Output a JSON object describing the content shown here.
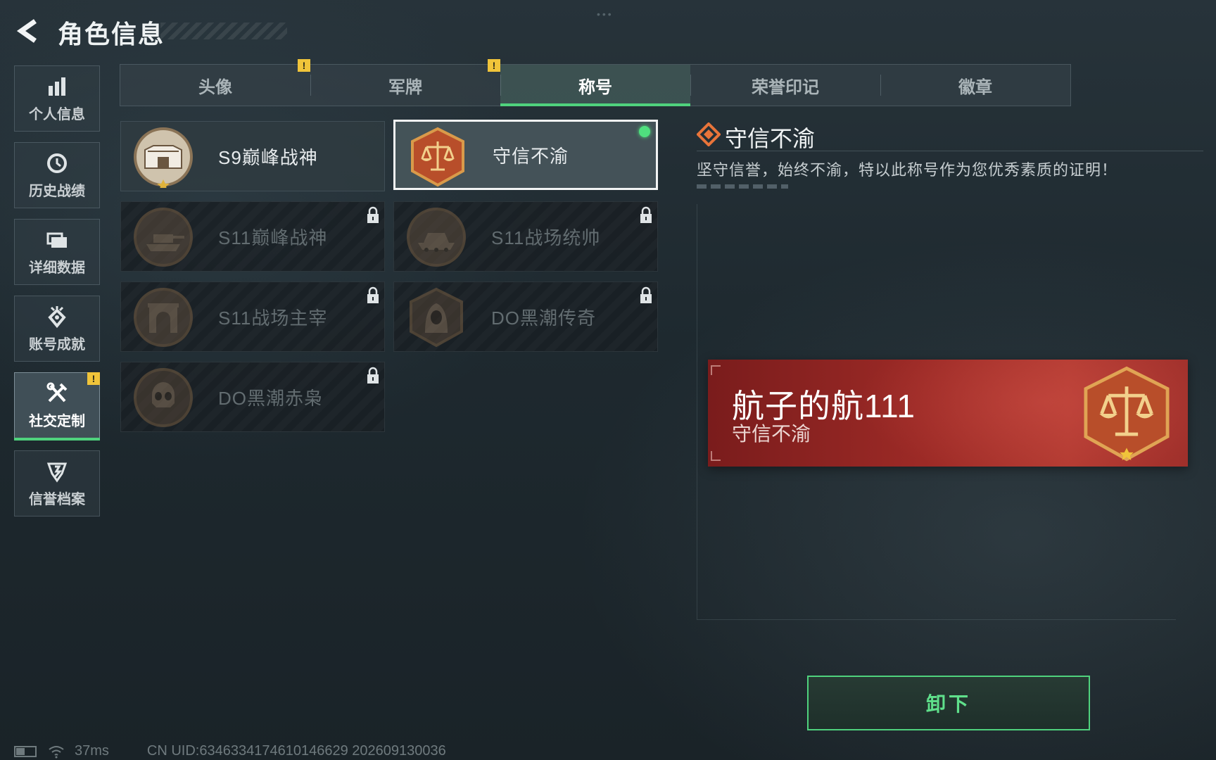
{
  "header": {
    "title": "角色信息"
  },
  "sidebar": {
    "items": [
      {
        "label": "个人信息",
        "icon": "bar-chart-icon"
      },
      {
        "label": "历史战绩",
        "icon": "history-clock-icon"
      },
      {
        "label": "详细数据",
        "icon": "folder-icon"
      },
      {
        "label": "账号成就",
        "icon": "achievement-icon"
      },
      {
        "label": "社交定制",
        "icon": "tools-icon",
        "active": true,
        "alert": "!"
      },
      {
        "label": "信誉档案",
        "icon": "credit-icon"
      }
    ]
  },
  "tabs": [
    {
      "label": "头像",
      "alert": "!"
    },
    {
      "label": "军牌",
      "alert": "!"
    },
    {
      "label": "称号",
      "active": true
    },
    {
      "label": "荣誉印记"
    },
    {
      "label": "徽章"
    }
  ],
  "titles": [
    {
      "name": "S9巅峰战神",
      "medal": "fortress-medal-icon",
      "locked": false
    },
    {
      "name": "守信不渝",
      "medal": "scales-medal-icon",
      "locked": false,
      "selected": true,
      "equipped": true
    },
    {
      "name": "S11巅峰战神",
      "medal": "tank-medal-icon",
      "locked": true
    },
    {
      "name": "S11战场统帅",
      "medal": "vehicle-medal-icon",
      "locked": true
    },
    {
      "name": "S11战场主宰",
      "medal": "arch-medal-icon",
      "locked": true
    },
    {
      "name": "DO黑潮传奇",
      "medal": "hooded-figure-medal-icon",
      "locked": true
    },
    {
      "name": "DO黑潮赤枭",
      "medal": "skull-medal-icon",
      "locked": true
    }
  ],
  "detail": {
    "title": "守信不渝",
    "description": "坚守信誉，始终不渝，特以此称号作为您优秀素质的证明！"
  },
  "nameplate": {
    "player_name": "航子的航111",
    "title": "守信不渝"
  },
  "actions": {
    "unequip_label": "卸下"
  },
  "status": {
    "ping": "37ms",
    "uid": "CN UID:6346334174610146629 202609130036"
  },
  "colors": {
    "accent_green": "#4fd27d",
    "alert_yellow": "#f0c43a",
    "nameplate_red": "#9c2a26",
    "medal_bronze": "#8a6a48"
  }
}
